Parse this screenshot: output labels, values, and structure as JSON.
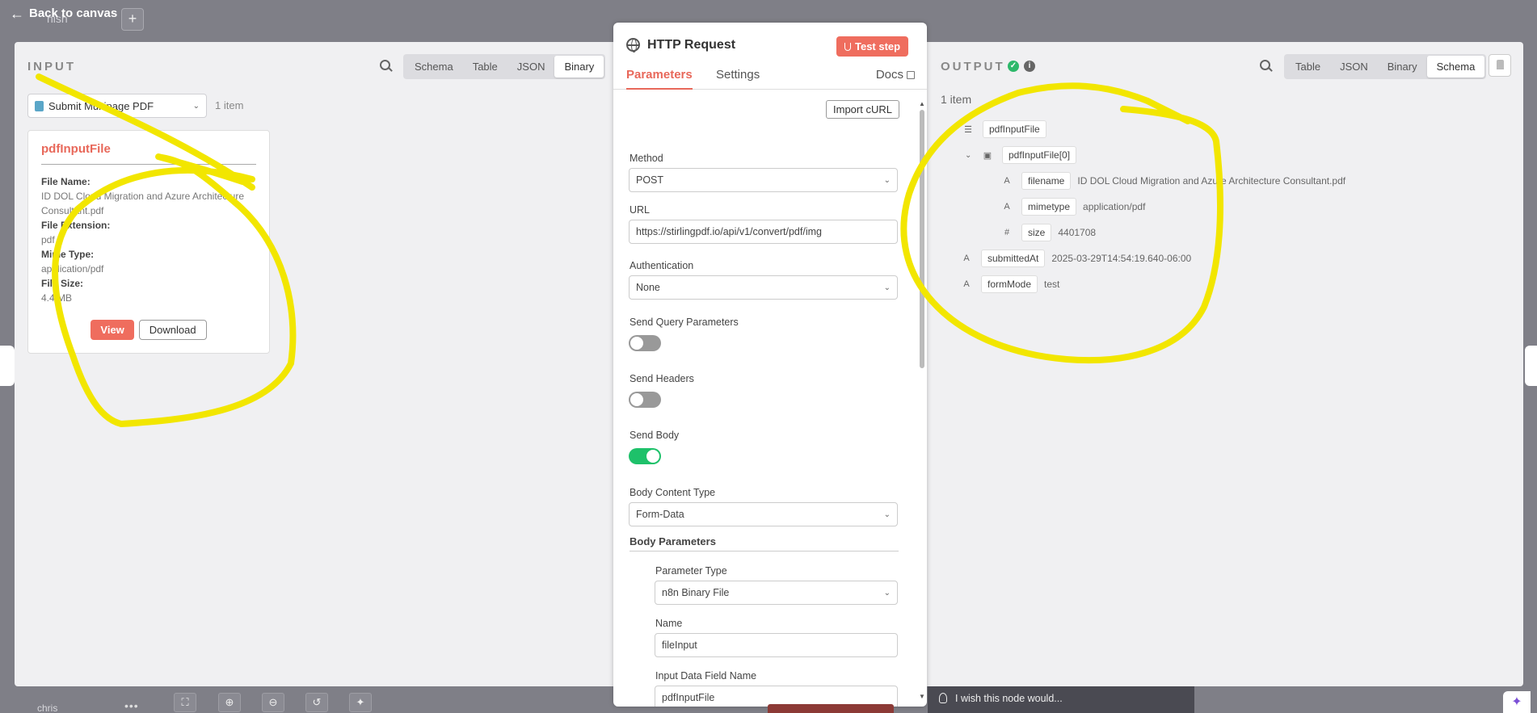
{
  "topbar": {
    "back_label": "Back to canvas",
    "ghost_text": "nish",
    "plus": "+"
  },
  "input": {
    "title": "INPUT",
    "tabs": [
      "Schema",
      "Table",
      "JSON",
      "Binary"
    ],
    "active_tab": "Binary",
    "node_select": "Submit Multipage PDF",
    "item_count": "1 item",
    "card": {
      "field_name": "pdfInputFile",
      "file_name_label": "File Name:",
      "file_name": "ID DOL Cloud Migration and Azure Architecture Consultant.pdf",
      "ext_label": "File Extension:",
      "ext": "pdf",
      "mime_label": "Mime Type:",
      "mime": "application/pdf",
      "size_label": "File Size:",
      "size": "4.4 MB",
      "view": "View",
      "download": "Download"
    }
  },
  "node": {
    "title": "HTTP Request",
    "test_step": "Test step",
    "tabs": {
      "parameters": "Parameters",
      "settings": "Settings",
      "docs": "Docs"
    },
    "import_curl": "Import cURL",
    "method_label": "Method",
    "method": "POST",
    "url_label": "URL",
    "url": "https://stirlingpdf.io/api/v1/convert/pdf/img",
    "auth_label": "Authentication",
    "auth": "None",
    "send_query_label": "Send Query Parameters",
    "send_headers_label": "Send Headers",
    "send_body_label": "Send Body",
    "body_type_label": "Body Content Type",
    "body_type": "Form-Data",
    "body_params_label": "Body Parameters",
    "param_type_label": "Parameter Type",
    "param_type": "n8n Binary File",
    "name_label": "Name",
    "name": "fileInput",
    "input_field_label": "Input Data Field Name",
    "input_field": "pdfInputFile"
  },
  "output": {
    "title": "OUTPUT",
    "tabs": [
      "Table",
      "JSON",
      "Binary",
      "Schema"
    ],
    "active_tab": "Schema",
    "item_count": "1 item",
    "tree": {
      "root": "pdfInputFile",
      "child": "pdfInputFile[0]",
      "filename_key": "filename",
      "filename_val": "ID DOL Cloud Migration and Azure Architecture Consultant.pdf",
      "mimetype_key": "mimetype",
      "mimetype_val": "application/pdf",
      "size_key": "size",
      "size_val": "4401708",
      "submitted_key": "submittedAt",
      "submitted_val": "2025-03-29T14:54:19.640-06:00",
      "formmode_key": "formMode",
      "formmode_val": "test"
    }
  },
  "bottom": {
    "user": "chris",
    "wish": "I wish this node would..."
  },
  "colors": {
    "accent": "#ef6d5e",
    "success": "#1ec16a",
    "annotation": "#f2e600"
  }
}
